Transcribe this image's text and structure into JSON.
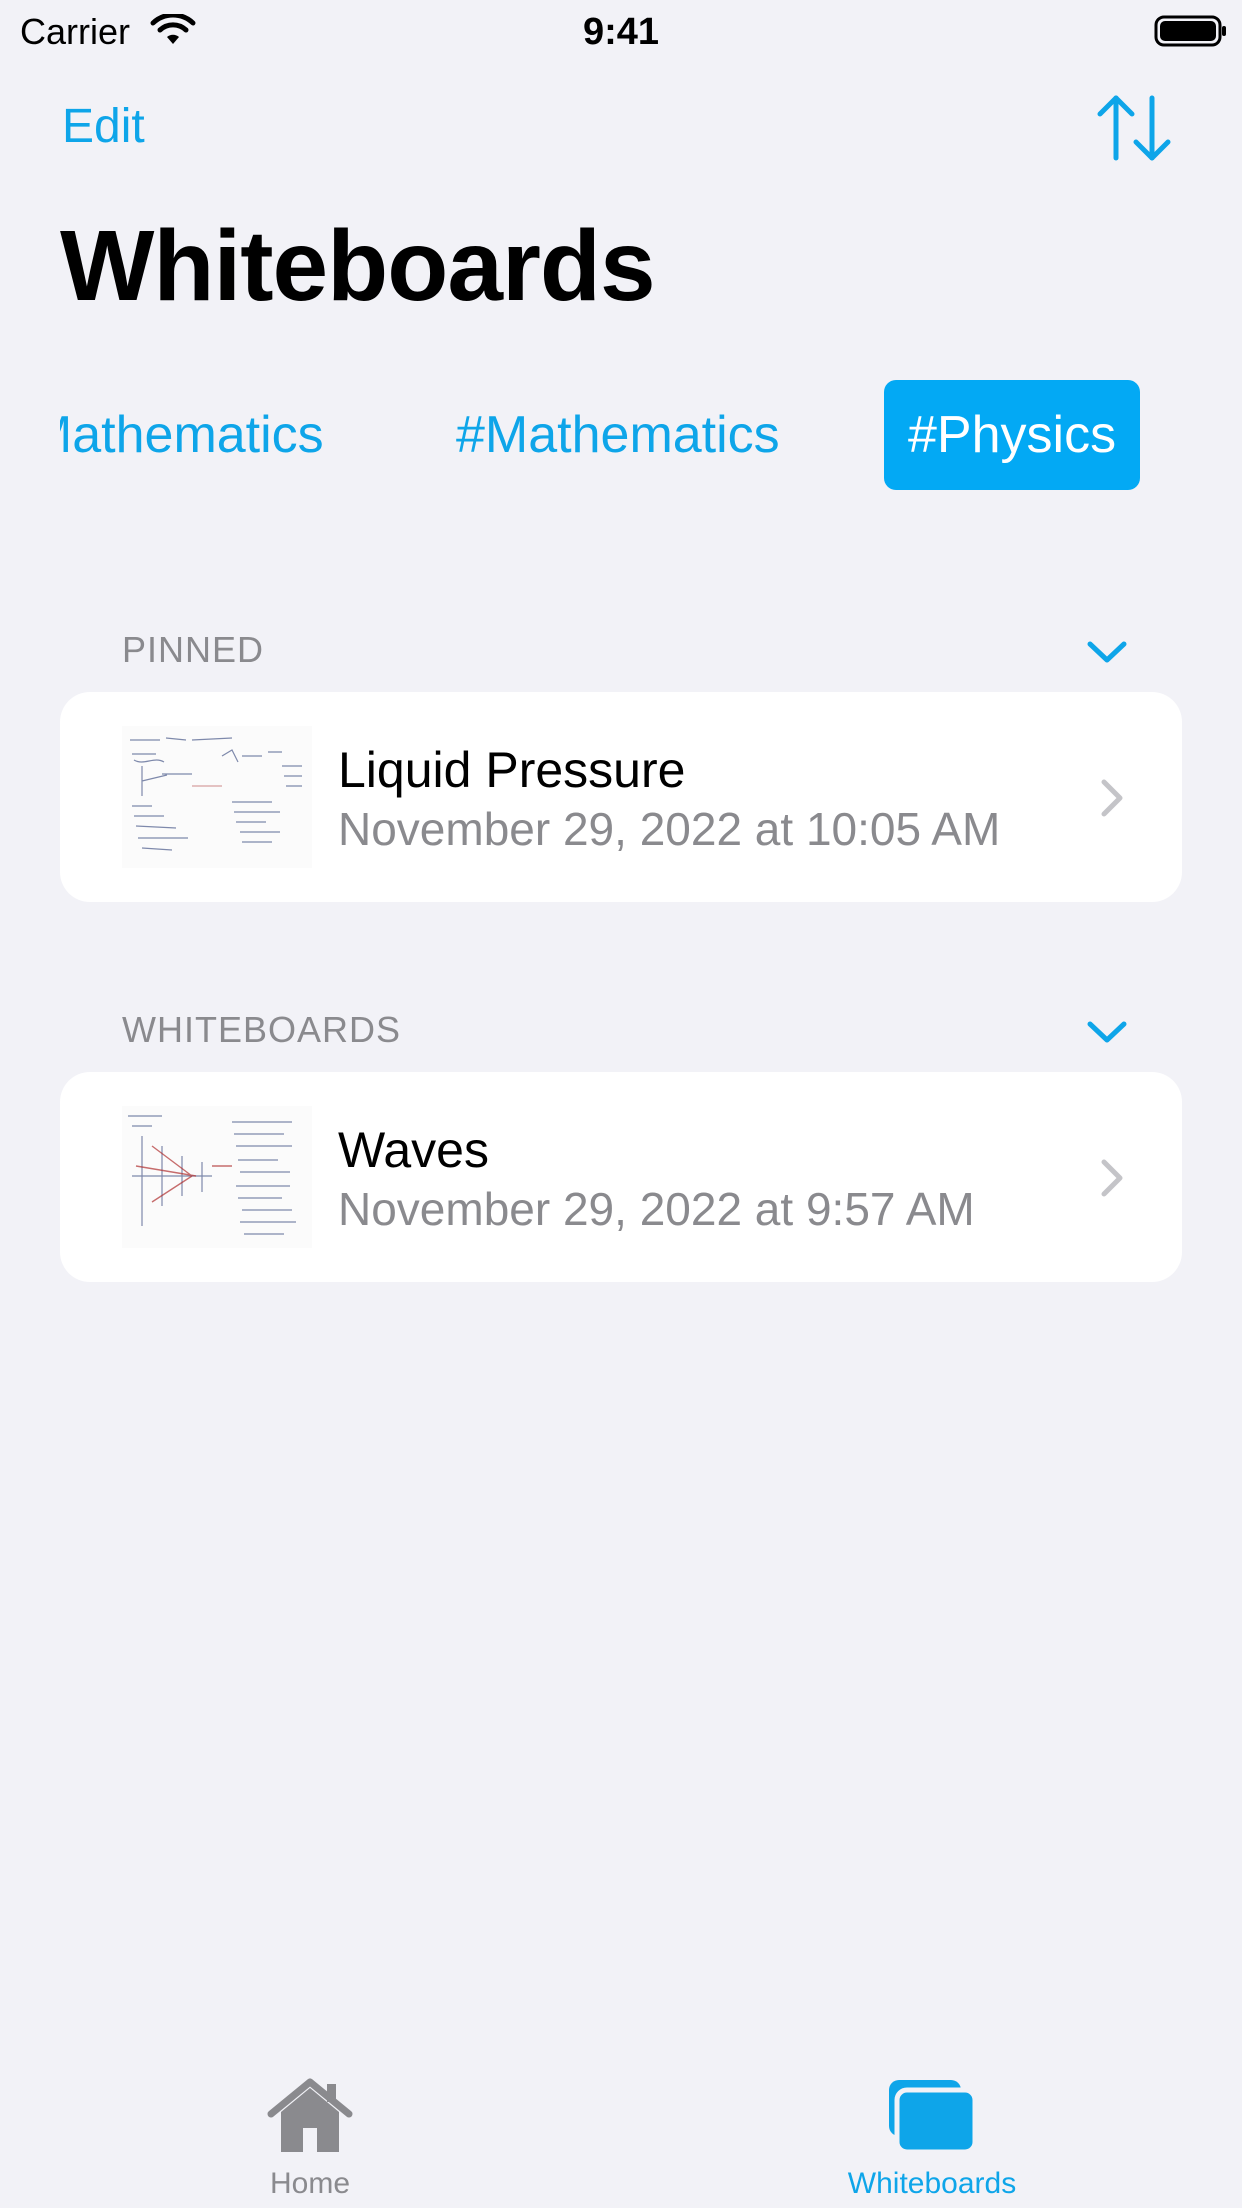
{
  "status_bar": {
    "carrier": "Carrier",
    "time": "9:41"
  },
  "nav": {
    "edit_label": "Edit",
    "sort_icon": "sort-arrows-icon",
    "title": "Whiteboards"
  },
  "tags": [
    {
      "label": "#Mathematics",
      "selected": false
    },
    {
      "label": "#Mathematics",
      "selected": false
    },
    {
      "label": "#Physics",
      "selected": true
    }
  ],
  "sections": {
    "pinned": {
      "header": "PINNED",
      "items": [
        {
          "title": "Liquid Pressure",
          "date": "November 29, 2022 at 10:05 AM"
        }
      ]
    },
    "whiteboards": {
      "header": "WHITEBOARDS",
      "items": [
        {
          "title": "Waves",
          "date": "November 29, 2022 at 9:57 AM"
        }
      ]
    }
  },
  "tab_bar": {
    "items": [
      {
        "label": "Home",
        "icon": "house-icon",
        "selected": false
      },
      {
        "label": "Whiteboards",
        "icon": "whiteboards-stack-icon",
        "selected": true
      }
    ]
  },
  "colors": {
    "accent": "#0ea5e9",
    "selected_tag_bg": "#03a9f4",
    "background": "#f2f2f7",
    "secondary_text": "#8a8a8e"
  }
}
